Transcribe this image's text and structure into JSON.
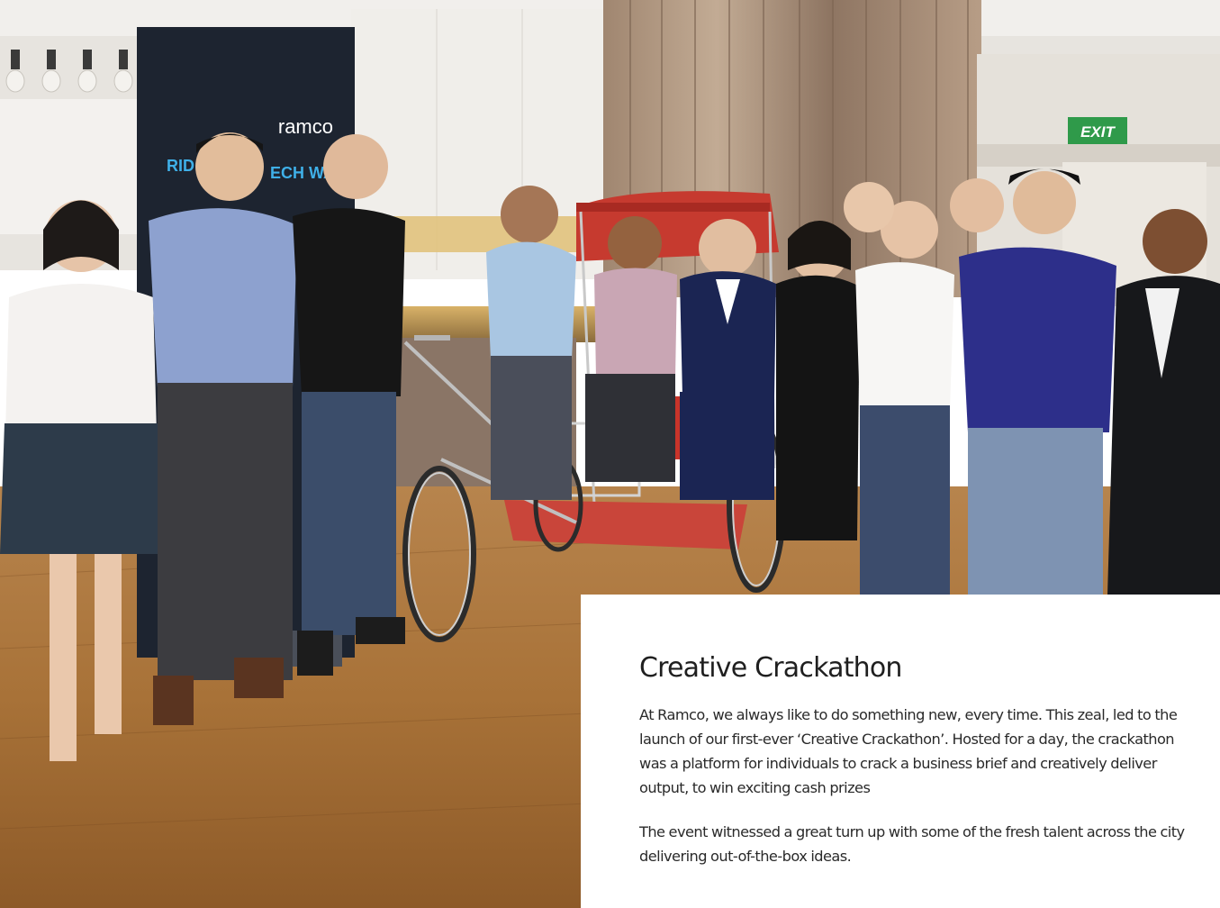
{
  "photo": {
    "banner_brand": "ramco",
    "banner_tagline": "RID",
    "banner_tagline_right": "ECH WA",
    "exit_sign": "EXIT"
  },
  "article": {
    "title": "Creative Crackathon",
    "paragraphs": [
      "At Ramco, we always like to do something new, every time. This zeal, led to the launch of our first-ever ‘Creative Crackathon’. Hosted for a day, the crackathon was a platform for individuals to crack a business brief and creatively deliver output, to win exciting cash prizes",
      "The event witnessed a great turn up with some of the fresh talent across the city delivering out-of-the-box ideas."
    ]
  }
}
